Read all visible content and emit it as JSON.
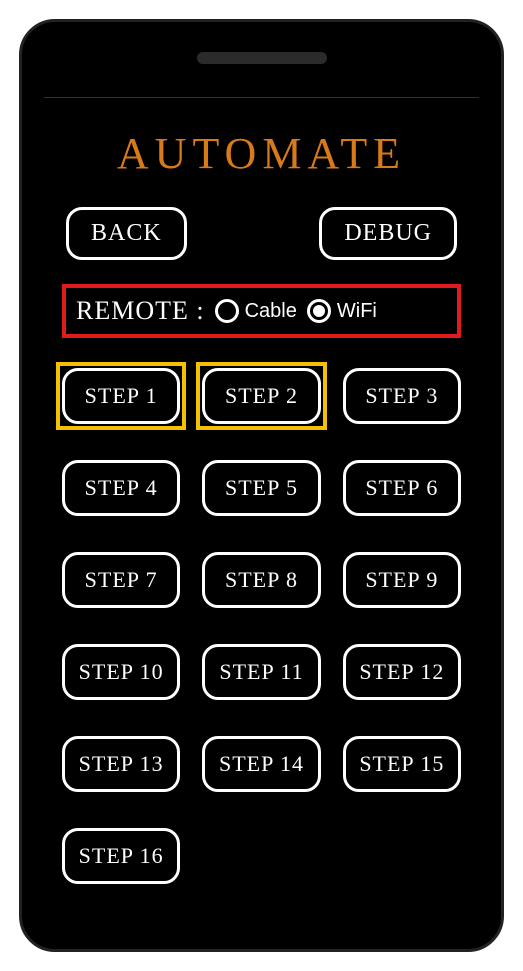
{
  "title": "AUTOMATE",
  "nav": {
    "back": "BACK",
    "debug": "DEBUG"
  },
  "remote": {
    "label": "REMOTE :",
    "options": {
      "cable": "Cable",
      "wifi": "WiFi"
    },
    "selected": "wifi"
  },
  "steps": [
    {
      "label": "STEP 1",
      "highlighted": true
    },
    {
      "label": "STEP 2",
      "highlighted": true
    },
    {
      "label": "STEP 3",
      "highlighted": false
    },
    {
      "label": "STEP 4",
      "highlighted": false
    },
    {
      "label": "STEP 5",
      "highlighted": false
    },
    {
      "label": "STEP 6",
      "highlighted": false
    },
    {
      "label": "STEP 7",
      "highlighted": false
    },
    {
      "label": "STEP 8",
      "highlighted": false
    },
    {
      "label": "STEP 9",
      "highlighted": false
    },
    {
      "label": "STEP 10",
      "highlighted": false
    },
    {
      "label": "STEP 11",
      "highlighted": false
    },
    {
      "label": "STEP 12",
      "highlighted": false
    },
    {
      "label": "STEP 13",
      "highlighted": false
    },
    {
      "label": "STEP 14",
      "highlighted": false
    },
    {
      "label": "STEP 15",
      "highlighted": false
    },
    {
      "label": "STEP 16",
      "highlighted": false
    }
  ],
  "colors": {
    "accent_title": "#d87a18",
    "highlight_border": "#f2c200",
    "remote_border": "#e11b1b"
  }
}
